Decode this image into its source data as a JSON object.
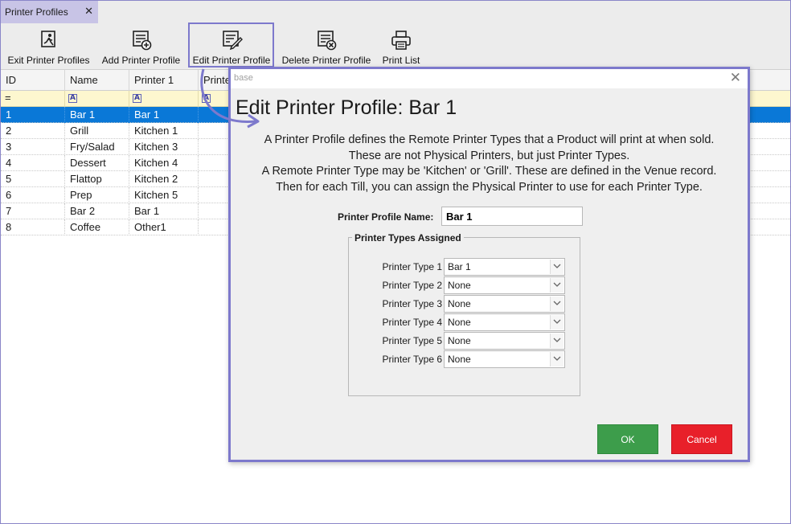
{
  "tab": {
    "label": "Printer Profiles",
    "close_glyph": "✕"
  },
  "toolbar": {
    "exit_label": "Exit Printer Profiles",
    "add_label": "Add Printer Profile",
    "edit_label": "Edit Printer Profile",
    "delete_label": "Delete Printer Profile",
    "print_label": "Print List"
  },
  "grid": {
    "columns": [
      "ID",
      "Name",
      "Printer 1",
      "Printe"
    ],
    "filter_symbol": "=",
    "filter_icon": "A",
    "rows": [
      {
        "id": "1",
        "name": "Bar 1",
        "printer1": "Bar 1"
      },
      {
        "id": "2",
        "name": "Grill",
        "printer1": "Kitchen 1"
      },
      {
        "id": "3",
        "name": "Fry/Salad",
        "printer1": "Kitchen 3"
      },
      {
        "id": "4",
        "name": "Dessert",
        "printer1": "Kitchen 4"
      },
      {
        "id": "5",
        "name": "Flattop",
        "printer1": "Kitchen 2"
      },
      {
        "id": "6",
        "name": "Prep",
        "printer1": "Kitchen 5"
      },
      {
        "id": "7",
        "name": "Bar 2",
        "printer1": "Bar 1"
      },
      {
        "id": "8",
        "name": "Coffee",
        "printer1": "Other1"
      }
    ]
  },
  "dialog": {
    "titlebar": "base",
    "close_glyph": "✕",
    "heading": "Edit Printer Profile: Bar 1",
    "description": [
      "A Printer Profile defines the Remote Printer Types that a Product will print at when sold.",
      "These are not Physical Printers, but just Printer Types.",
      "A Remote Printer Type may be 'Kitchen' or 'Grill'. These are defined in the Venue record.",
      "Then for each Till, you can assign the Physical Printer to use for each Printer Type."
    ],
    "name_label": "Printer Profile Name:",
    "name_value": "Bar 1",
    "group_title": "Printer Types Assigned",
    "printer_types": [
      {
        "label": "Printer Type 1",
        "value": "Bar 1"
      },
      {
        "label": "Printer Type 2",
        "value": "None"
      },
      {
        "label": "Printer Type 3",
        "value": "None"
      },
      {
        "label": "Printer Type 4",
        "value": "None"
      },
      {
        "label": "Printer Type 5",
        "value": "None"
      },
      {
        "label": "Printer Type 6",
        "value": "None"
      }
    ],
    "ok_label": "OK",
    "cancel_label": "Cancel"
  },
  "colors": {
    "selection": "#0a78d7",
    "highlight_border": "#7d79cc",
    "ok_button": "#3d9d4b",
    "cancel_button": "#e8202a",
    "filter_row": "#fdf7cf"
  }
}
